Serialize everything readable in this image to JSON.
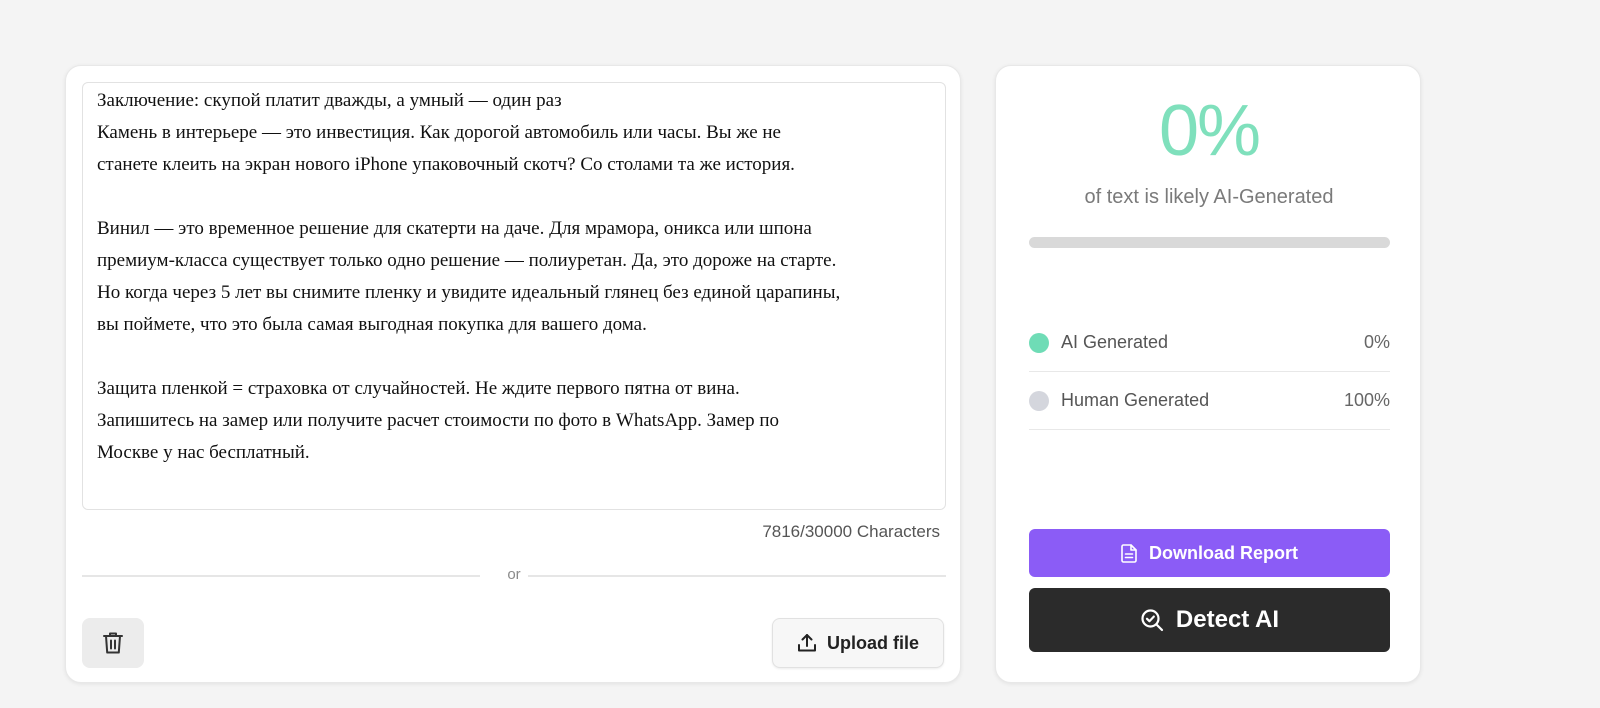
{
  "editor": {
    "paragraphs": [
      [
        "Заключение: скупой платит дважды, а умный — один раз",
        "Камень в интерьере — это инвестиция. Как дорогой автомобиль или часы. Вы же не",
        "станете клеить на экран нового iPhone упаковочный скотч? Со столами та же история."
      ],
      [
        "Винил — это временное решение для скатерти на даче. Для мрамора, оникса или шпона",
        "премиум-класса существует только одно решение — полиуретан. Да, это дороже на старте.",
        "Но когда через 5 лет вы снимите пленку и увидите идеальный глянец без единой царапины,",
        "вы поймете, что это была самая выгодная покупка для вашего дома."
      ],
      [
        "Защита пленкой = страховка от случайностей. Не ждите первого пятна от вина.",
        "Запишитесь на замер или получите расчет стоимости по фото в WhatsApp. Замер по",
        "Москве у нас бесплатный."
      ]
    ],
    "char_count": "7816/30000 Characters",
    "divider_text": "or",
    "delete_icon": "trash-icon",
    "upload_icon": "upload-icon",
    "upload_label": "Upload file"
  },
  "result": {
    "percent_label": "0%",
    "subtitle": "of text is likely AI-Generated",
    "ai_fraction": 0,
    "ai": {
      "label": "AI Generated",
      "value": "0%",
      "color": "#6fdcb6"
    },
    "human": {
      "label": "Human Generated",
      "value": "100%",
      "color": "#d4d6dd"
    },
    "download_icon": "document-icon",
    "download_label": "Download Report",
    "detect_icon": "search-check-icon",
    "detect_label": "Detect AI",
    "accent_purple": "#8b5cf6",
    "accent_green": "#7fe0bc"
  }
}
